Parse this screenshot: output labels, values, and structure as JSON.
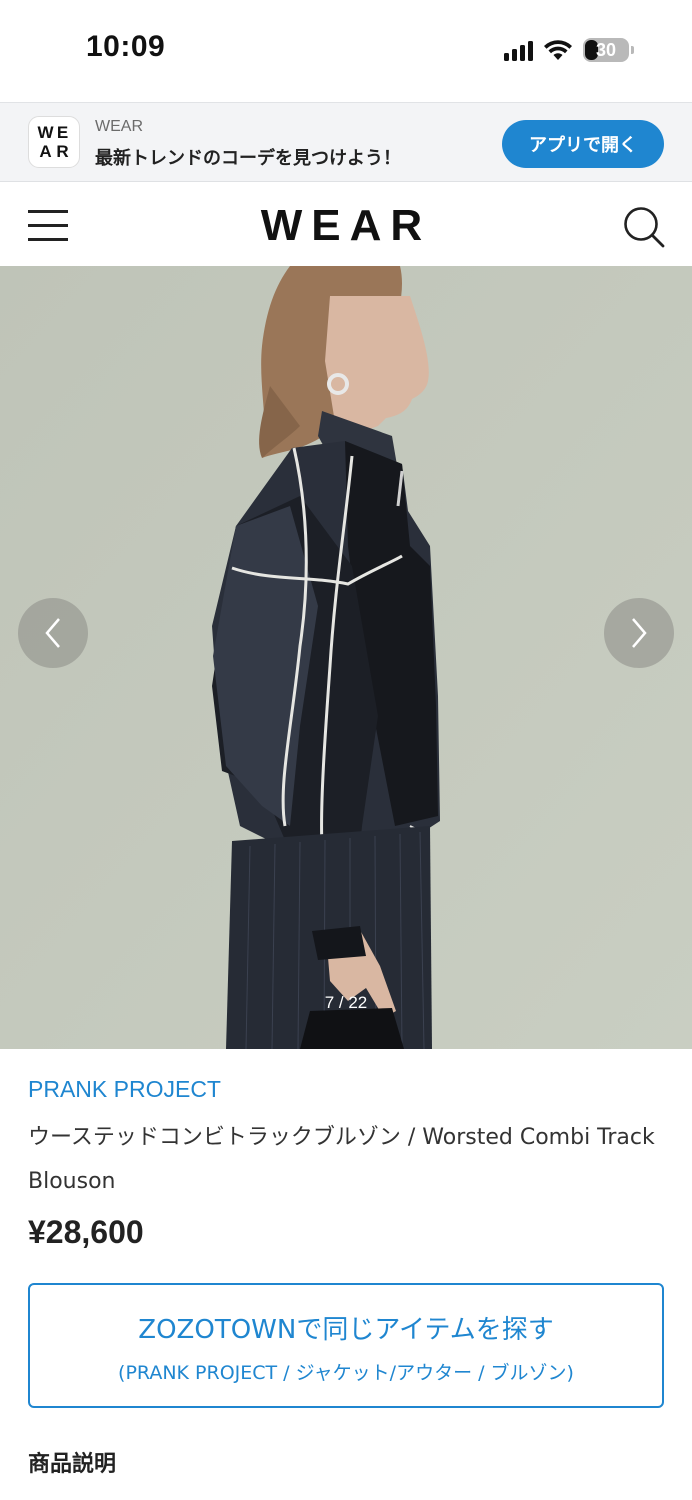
{
  "status_bar": {
    "time": "10:09",
    "battery": "30",
    "battery_level": 0.3
  },
  "app_banner": {
    "logo_letters": [
      "W",
      "E",
      "A",
      "R"
    ],
    "subtitle": "WEAR",
    "message": "最新トレンドのコーデを見つけよう！",
    "open_button": "アプリで開く",
    "accent_color": "#1f86d0"
  },
  "header": {
    "logo": "WEAR",
    "menu_icon": "hamburger-menu-icon",
    "search_icon": "search-icon"
  },
  "carousel": {
    "counter": "7 / 22",
    "prev_icon": "chevron-left-icon",
    "next_icon": "chevron-right-icon"
  },
  "product": {
    "brand": "PRANK PROJECT",
    "name": "ウーステッドコンビトラックブルゾン / Worsted Combi Track Blouson",
    "price": "¥28,600"
  },
  "zozo_button": {
    "title": "ZOZOTOWNで同じアイテムを探す",
    "subtitle": "(PRANK PROJECT / ジャケット/アウター / ブルゾン)"
  },
  "sections": {
    "description_title": "商品説明"
  }
}
